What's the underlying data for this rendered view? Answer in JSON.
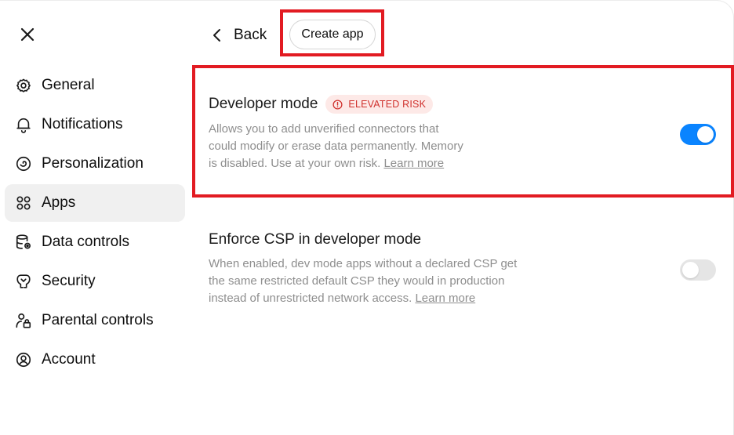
{
  "sidebar": {
    "items": [
      {
        "label": "General",
        "icon": "gear-icon"
      },
      {
        "label": "Notifications",
        "icon": "bell-icon"
      },
      {
        "label": "Personalization",
        "icon": "personalization-icon"
      },
      {
        "label": "Apps",
        "icon": "apps-grid-icon",
        "active": true
      },
      {
        "label": "Data controls",
        "icon": "database-icon"
      },
      {
        "label": "Security",
        "icon": "security-icon"
      },
      {
        "label": "Parental controls",
        "icon": "parental-icon"
      },
      {
        "label": "Account",
        "icon": "account-icon"
      }
    ]
  },
  "header": {
    "back_label": "Back",
    "create_app_label": "Create app"
  },
  "settings": {
    "developer_mode": {
      "title": "Developer mode",
      "badge": "ELEVATED RISK",
      "desc_line1": "Allows you to add unverified connectors that",
      "desc_line2": "could modify or erase data permanently. Memory",
      "desc_line3": "is disabled. Use at your own risk.",
      "link": "Learn more",
      "enabled": true
    },
    "enforce_csp": {
      "title": "Enforce CSP in developer mode",
      "desc_line1": "When enabled, dev mode apps without a declared CSP get",
      "desc_line2": "the same restricted default CSP they would in production",
      "desc_line3": "instead of unrestricted network access.",
      "link": "Learn more",
      "enabled": false
    }
  },
  "colors": {
    "accent": "#0a84ff",
    "highlight": "#e21b22",
    "badge_text": "#d0312d",
    "badge_bg": "#fde9e7"
  }
}
